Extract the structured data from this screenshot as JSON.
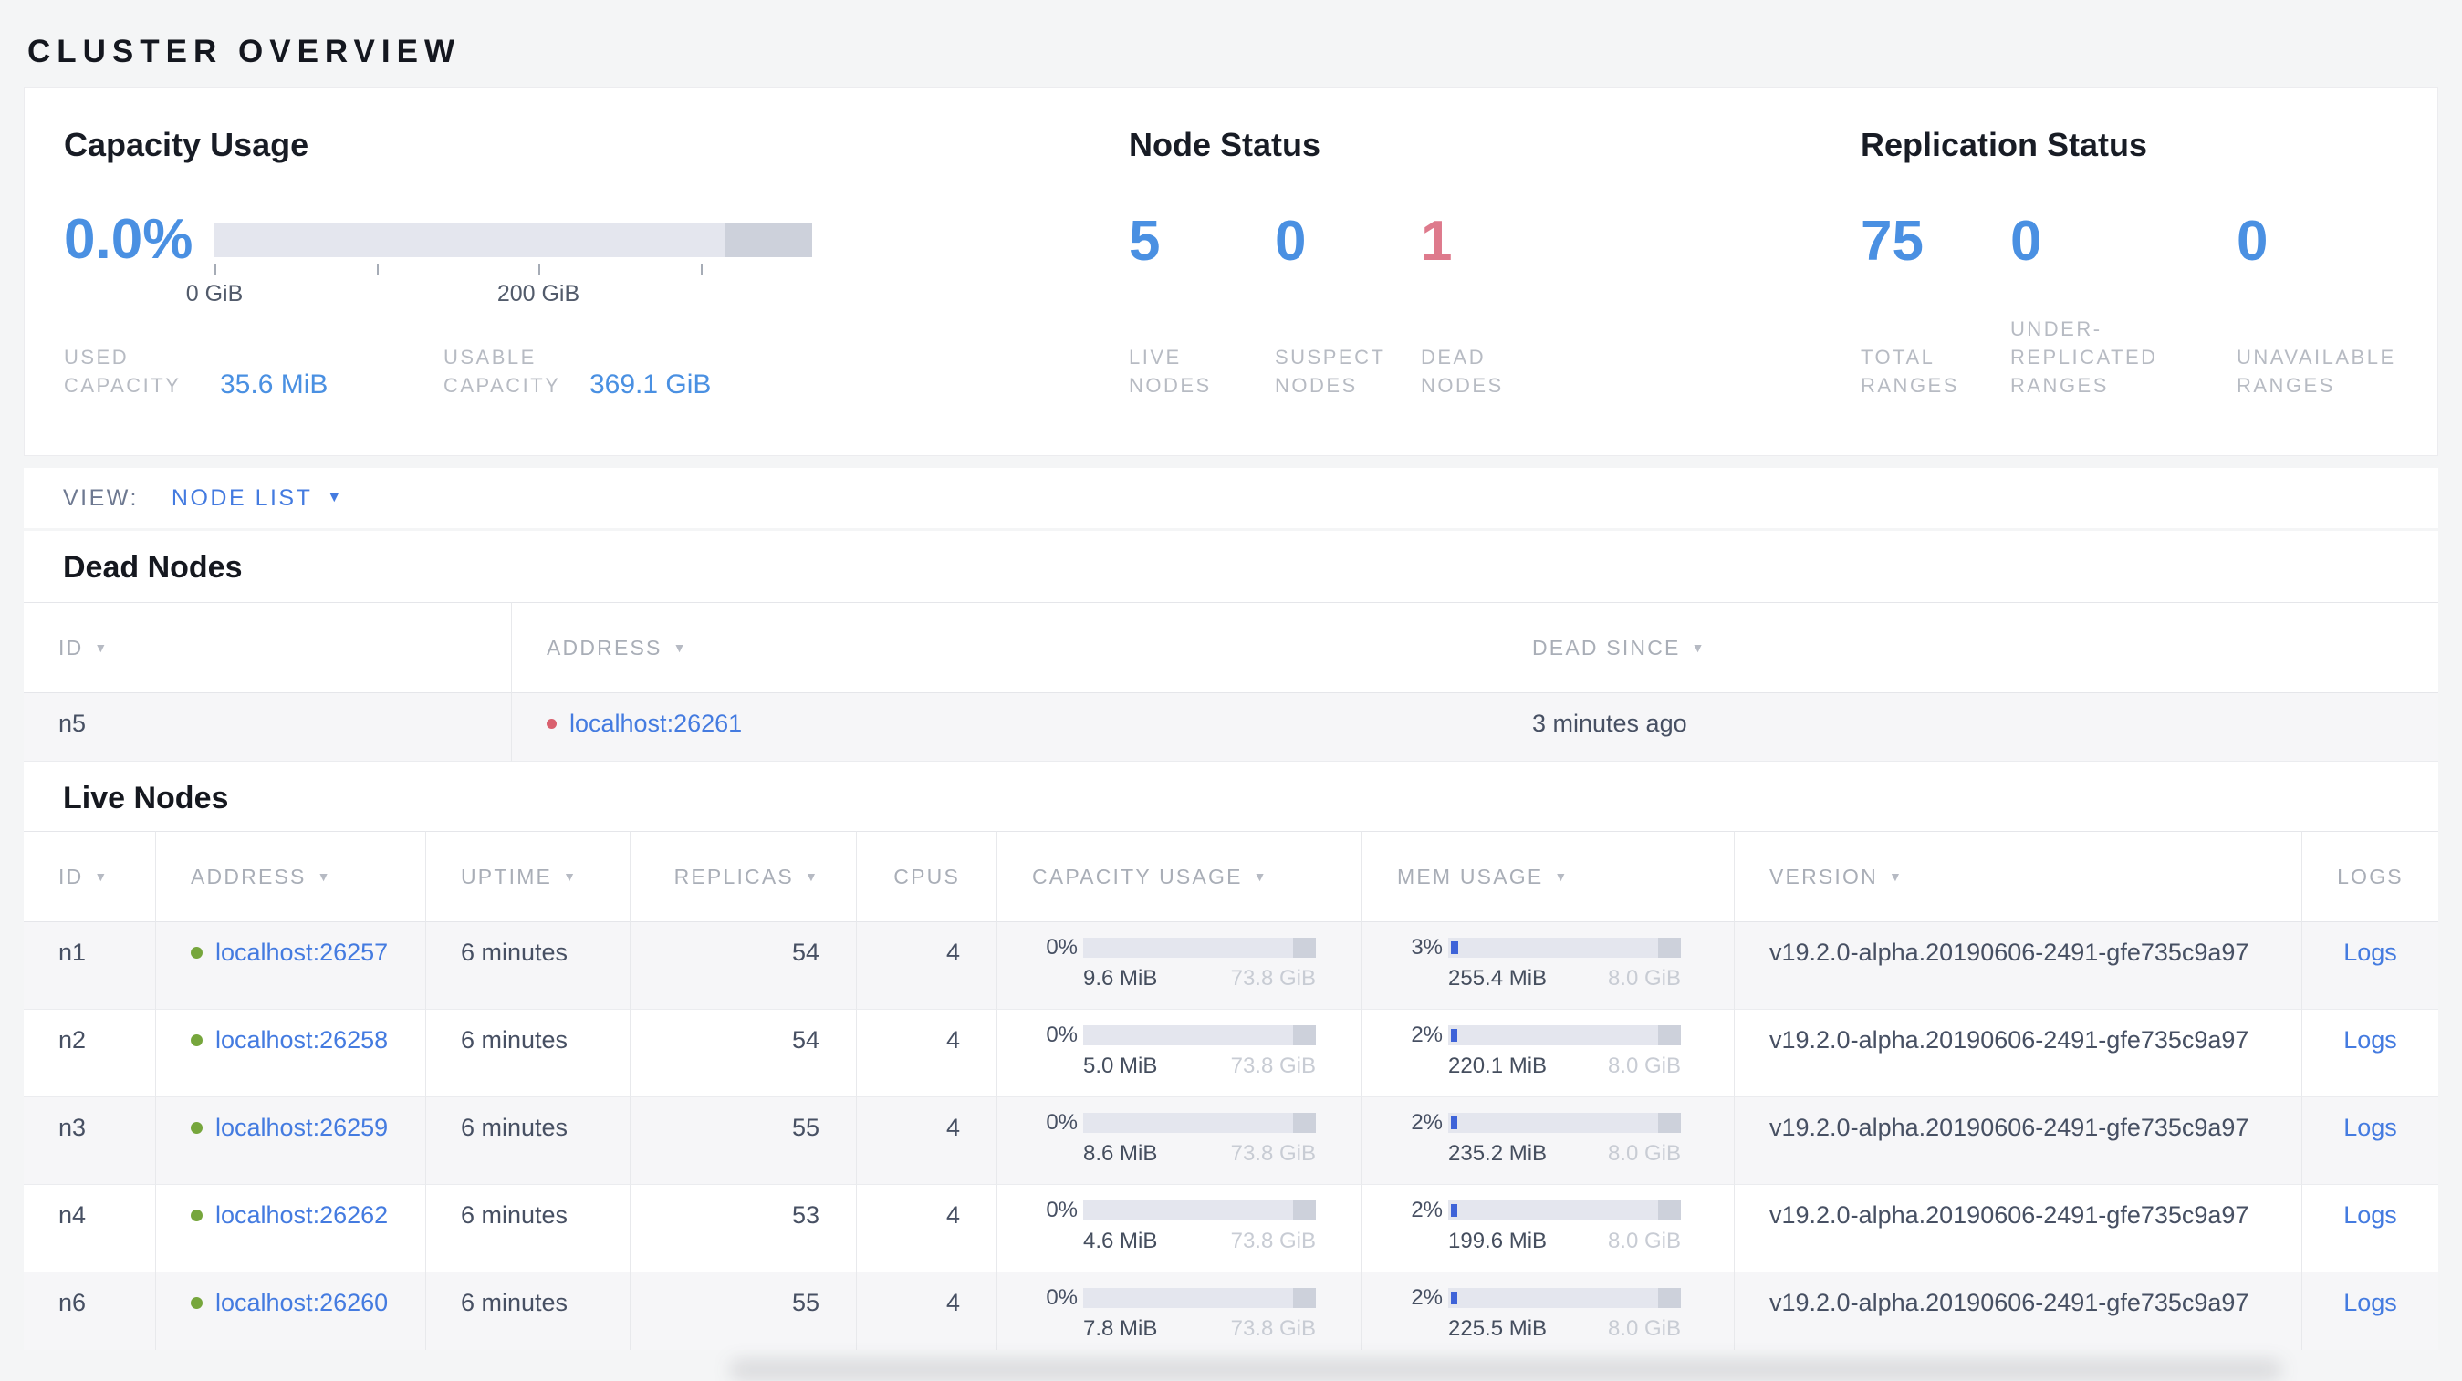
{
  "page": {
    "title": "CLUSTER OVERVIEW"
  },
  "colors": {
    "accent_blue": "#4a90e2",
    "link_blue": "#447be0",
    "status_red": "#de7a8c",
    "dead_dot_red": "#d9606e",
    "live_dot_green": "#76a63c",
    "mem_fill_blue": "#3e63d8"
  },
  "summary": {
    "capacity": {
      "title": "Capacity Usage",
      "percent": "0.0%",
      "used_pct": 0,
      "other_segment_start_pct": 85.3,
      "axis": {
        "ticks": [
          {
            "pos_pct": 0,
            "label": "0 GiB"
          },
          {
            "pos_pct": 27.1,
            "label": ""
          },
          {
            "pos_pct": 54.2,
            "label": "200 GiB"
          },
          {
            "pos_pct": 81.3,
            "label": ""
          }
        ]
      },
      "legend": [
        {
          "label": "USED CAPACITY",
          "value": "35.6 MiB"
        },
        {
          "label": "USABLE CAPACITY",
          "value": "369.1 GiB"
        }
      ]
    },
    "node_status": {
      "title": "Node Status",
      "stats": [
        {
          "value": "5",
          "label": "LIVE NODES",
          "color": "blue"
        },
        {
          "value": "0",
          "label": "SUSPECT NODES",
          "color": "blue"
        },
        {
          "value": "1",
          "label": "DEAD NODES",
          "color": "red"
        }
      ]
    },
    "replication": {
      "title": "Replication Status",
      "stats": [
        {
          "value": "75",
          "label": "TOTAL RANGES",
          "color": "blue"
        },
        {
          "value": "0",
          "label": "UNDER-REPLICATED RANGES",
          "color": "blue"
        },
        {
          "value": "0",
          "label": "UNAVAILABLE RANGES",
          "color": "blue"
        }
      ]
    }
  },
  "view_bar": {
    "label": "VIEW:",
    "selected": "NODE LIST",
    "caret": "▼"
  },
  "dead_nodes": {
    "title": "Dead Nodes",
    "columns": [
      {
        "label": "ID",
        "sort": true
      },
      {
        "label": "ADDRESS",
        "sort": true
      },
      {
        "label": "DEAD SINCE",
        "sort": true
      }
    ],
    "rows": [
      {
        "id": "n5",
        "address": "localhost:26261",
        "dead_since": "3 minutes ago"
      }
    ]
  },
  "live_nodes": {
    "title": "Live Nodes",
    "columns": [
      {
        "label": "ID",
        "sort": true,
        "align": "left"
      },
      {
        "label": "ADDRESS",
        "sort": true,
        "align": "left"
      },
      {
        "label": "UPTIME",
        "sort": true,
        "align": "left"
      },
      {
        "label": "REPLICAS",
        "sort": true,
        "align": "right"
      },
      {
        "label": "CPUS",
        "sort": false,
        "align": "right"
      },
      {
        "label": "CAPACITY USAGE",
        "sort": true,
        "align": "left"
      },
      {
        "label": "MEM USAGE",
        "sort": true,
        "align": "left"
      },
      {
        "label": "VERSION",
        "sort": true,
        "align": "left"
      },
      {
        "label": "LOGS",
        "sort": false,
        "align": "center"
      }
    ],
    "rows": [
      {
        "id": "n1",
        "address": "localhost:26257",
        "uptime": "6 minutes",
        "replicas": "54",
        "cpus": "4",
        "capacity": {
          "pct": "0%",
          "fill_pct": 0,
          "used": "9.6 MiB",
          "total": "73.8 GiB"
        },
        "mem": {
          "pct": "3%",
          "fill_pct": 3,
          "used": "255.4 MiB",
          "total": "8.0 GiB"
        },
        "version": "v19.2.0-alpha.20190606-2491-gfe735c9a97",
        "logs": "Logs"
      },
      {
        "id": "n2",
        "address": "localhost:26258",
        "uptime": "6 minutes",
        "replicas": "54",
        "cpus": "4",
        "capacity": {
          "pct": "0%",
          "fill_pct": 0,
          "used": "5.0 MiB",
          "total": "73.8 GiB"
        },
        "mem": {
          "pct": "2%",
          "fill_pct": 2,
          "used": "220.1 MiB",
          "total": "8.0 GiB"
        },
        "version": "v19.2.0-alpha.20190606-2491-gfe735c9a97",
        "logs": "Logs"
      },
      {
        "id": "n3",
        "address": "localhost:26259",
        "uptime": "6 minutes",
        "replicas": "55",
        "cpus": "4",
        "capacity": {
          "pct": "0%",
          "fill_pct": 0,
          "used": "8.6 MiB",
          "total": "73.8 GiB"
        },
        "mem": {
          "pct": "2%",
          "fill_pct": 2,
          "used": "235.2 MiB",
          "total": "8.0 GiB"
        },
        "version": "v19.2.0-alpha.20190606-2491-gfe735c9a97",
        "logs": "Logs"
      },
      {
        "id": "n4",
        "address": "localhost:26262",
        "uptime": "6 minutes",
        "replicas": "53",
        "cpus": "4",
        "capacity": {
          "pct": "0%",
          "fill_pct": 0,
          "used": "4.6 MiB",
          "total": "73.8 GiB"
        },
        "mem": {
          "pct": "2%",
          "fill_pct": 2,
          "used": "199.6 MiB",
          "total": "8.0 GiB"
        },
        "version": "v19.2.0-alpha.20190606-2491-gfe735c9a97",
        "logs": "Logs"
      },
      {
        "id": "n6",
        "address": "localhost:26260",
        "uptime": "6 minutes",
        "replicas": "55",
        "cpus": "4",
        "capacity": {
          "pct": "0%",
          "fill_pct": 0,
          "used": "7.8 MiB",
          "total": "73.8 GiB"
        },
        "mem": {
          "pct": "2%",
          "fill_pct": 2,
          "used": "225.5 MiB",
          "total": "8.0 GiB"
        },
        "version": "v19.2.0-alpha.20190606-2491-gfe735c9a97",
        "logs": "Logs"
      }
    ]
  }
}
